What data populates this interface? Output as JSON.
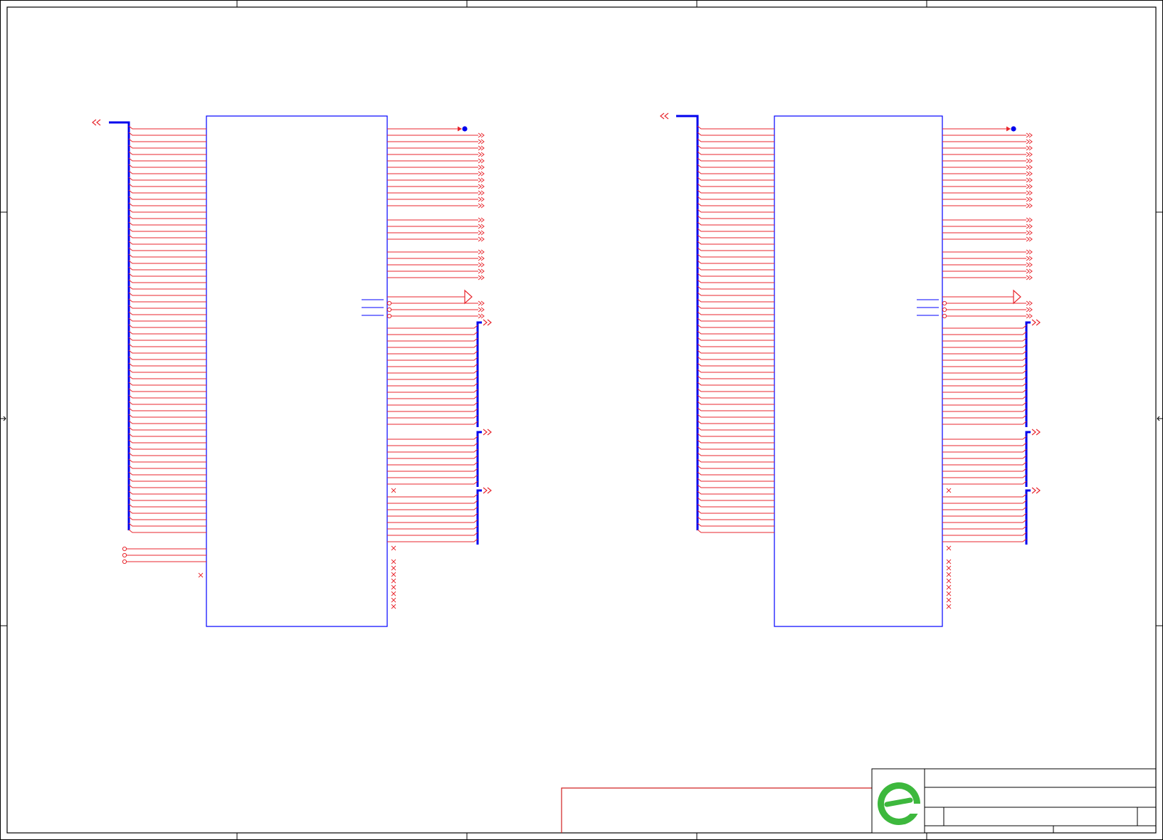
{
  "colors": {
    "frame": "#000000",
    "component": "#0000ff",
    "wire": "#e8262d",
    "bus": "#0000ee",
    "sheet_border": "#d02020",
    "logo_green": "#3db83d"
  },
  "icons": {
    "left_bus_connector": "double-chevron-left-icon",
    "right_bus_connector": "double-chevron-right-icon",
    "pin_connector": "zigzag-connector-icon",
    "power_flag": "triangle-flag-icon",
    "net_dot": "junction-dot-icon",
    "no_connect": "cross-mark-icon",
    "logo": "company-logo-icon"
  },
  "components": [
    {
      "id": "U1"
    },
    {
      "id": "U2"
    }
  ],
  "title_block": {
    "title": "",
    "sheet": "",
    "rev": ""
  }
}
